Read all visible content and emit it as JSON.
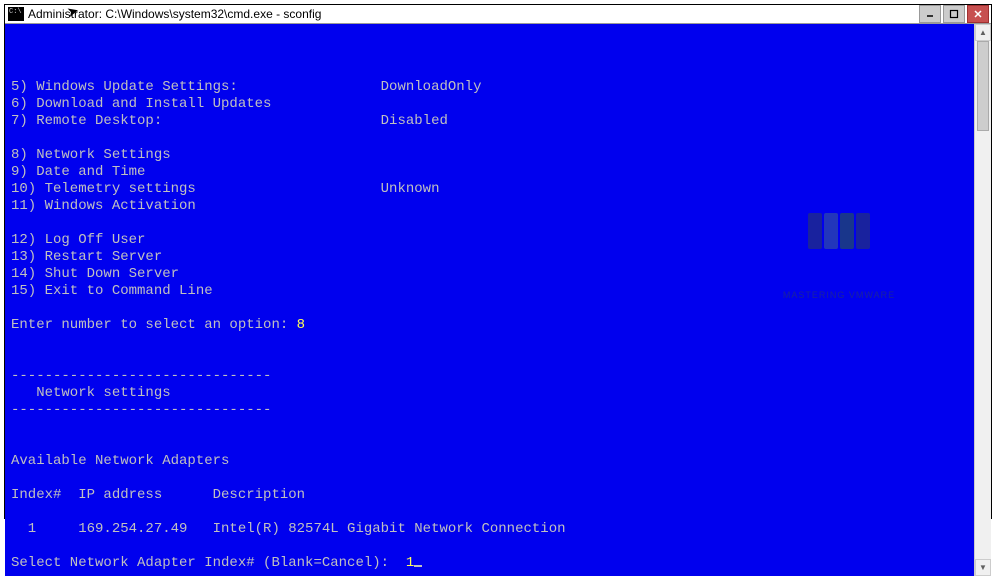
{
  "titlebar": {
    "title": "Administrator: C:\\Windows\\system32\\cmd.exe - sconfig"
  },
  "menu": {
    "items": [
      {
        "num": "5",
        "label": "Windows Update Settings:",
        "value": "DownloadOnly"
      },
      {
        "num": "6",
        "label": "Download and Install Updates",
        "value": ""
      },
      {
        "num": "7",
        "label": "Remote Desktop:",
        "value": "Disabled"
      },
      {
        "num": "8",
        "label": "Network Settings",
        "value": ""
      },
      {
        "num": "9",
        "label": "Date and Time",
        "value": ""
      },
      {
        "num": "10",
        "label": "Telemetry settings",
        "value": "Unknown"
      },
      {
        "num": "11",
        "label": "Windows Activation",
        "value": ""
      },
      {
        "num": "12",
        "label": "Log Off User",
        "value": ""
      },
      {
        "num": "13",
        "label": "Restart Server",
        "value": ""
      },
      {
        "num": "14",
        "label": "Shut Down Server",
        "value": ""
      },
      {
        "num": "15",
        "label": "Exit to Command Line",
        "value": ""
      }
    ]
  },
  "prompt1": {
    "text": "Enter number to select an option:",
    "input": "8"
  },
  "section": {
    "dashes": "-------------------------------",
    "title": "   Network settings"
  },
  "adapters": {
    "heading": "Available Network Adapters",
    "col1": "Index#",
    "col2": "IP address",
    "col3": "Description",
    "rows": [
      {
        "index": "1",
        "ip": "169.254.27.49",
        "desc": "Intel(R) 82574L Gigabit Network Connection"
      }
    ]
  },
  "prompt2": {
    "text": "Select Network Adapter Index# (Blank=Cancel):",
    "input": "1"
  },
  "watermark": "MASTERING VMWARE"
}
